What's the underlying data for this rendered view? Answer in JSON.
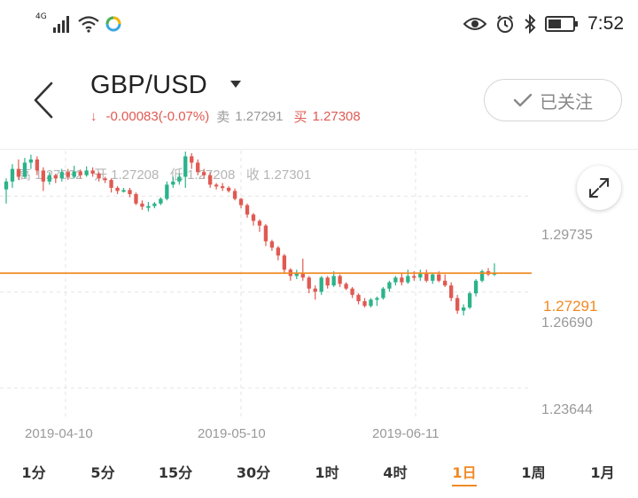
{
  "status_bar": {
    "network": "4G",
    "time": "7:52",
    "icons": [
      "signal-icon",
      "wifi-icon",
      "app-notification-icon",
      "eye-icon",
      "alarm-icon",
      "bluetooth-icon",
      "battery-icon"
    ]
  },
  "header": {
    "pair": "GBP/USD",
    "change_arrow": "↓",
    "change": "-0.00083(-0.07%)",
    "sell_label": "卖",
    "sell_price": "1.27291",
    "buy_label": "买",
    "buy_price": "1.27308",
    "follow_label": "已关注"
  },
  "ohlc": {
    "high_label": "高",
    "high": "1.27832",
    "open_label": "开",
    "open": "1.27208",
    "low_label": "低",
    "low": "1.27208",
    "close_label": "收",
    "close": "1.27301"
  },
  "colors": {
    "accent": "#f08a24",
    "down": "#e05a52",
    "up": "#2bb38a",
    "grid": "#e5e5e5"
  },
  "chart_data": {
    "type": "candlestick",
    "y_ticks": [
      "1.29735",
      "1.26690",
      "1.23644"
    ],
    "current_price": "1.27291",
    "x_ticks": [
      "2019-04-10",
      "2019-05-10",
      "2019-06-11"
    ],
    "ylim": [
      1.2274,
      1.3118
    ],
    "grid": true,
    "candles": [
      [
        1.2995,
        1.302,
        1.295,
        1.303
      ],
      [
        1.302,
        1.306,
        1.3,
        1.3075
      ],
      [
        1.306,
        1.3035,
        1.3025,
        1.309
      ],
      [
        1.3035,
        1.308,
        1.303,
        1.3095
      ],
      [
        1.308,
        1.309,
        1.306,
        1.3105
      ],
      [
        1.309,
        1.3055,
        1.304,
        1.31
      ],
      [
        1.3055,
        1.302,
        1.299,
        1.3065
      ],
      [
        1.302,
        1.304,
        1.301,
        1.305
      ],
      [
        1.304,
        1.303,
        1.3015,
        1.3045
      ],
      [
        1.303,
        1.305,
        1.302,
        1.306
      ],
      [
        1.305,
        1.3035,
        1.3025,
        1.306
      ],
      [
        1.3035,
        1.3052,
        1.303,
        1.307
      ],
      [
        1.3052,
        1.304,
        1.303,
        1.3058
      ],
      [
        1.304,
        1.3055,
        1.3035,
        1.3068
      ],
      [
        1.3055,
        1.3045,
        1.3035,
        1.3065
      ],
      [
        1.3045,
        1.303,
        1.302,
        1.305
      ],
      [
        1.303,
        1.3025,
        1.3015,
        1.3035
      ],
      [
        1.3025,
        1.3,
        1.2985,
        1.303
      ],
      [
        1.3,
        1.299,
        1.298,
        1.3005
      ],
      [
        1.299,
        1.2993,
        1.2985,
        1.3
      ],
      [
        1.2993,
        1.298,
        1.297,
        1.3
      ],
      [
        1.298,
        1.295,
        1.2945,
        1.2985
      ],
      [
        1.295,
        1.294,
        1.293,
        1.296
      ],
      [
        1.294,
        1.2942,
        1.2925,
        1.2955
      ],
      [
        1.2942,
        1.295,
        1.2935,
        1.2955
      ],
      [
        1.295,
        1.2965,
        1.2945,
        1.297
      ],
      [
        1.2965,
        1.301,
        1.296,
        1.302
      ],
      [
        1.301,
        1.302,
        1.3,
        1.3035
      ],
      [
        1.302,
        1.3035,
        1.301,
        1.3045
      ],
      [
        1.3035,
        1.31,
        1.3,
        1.3115
      ],
      [
        1.31,
        1.308,
        1.306,
        1.311
      ],
      [
        1.308,
        1.305,
        1.304,
        1.309
      ],
      [
        1.305,
        1.304,
        1.303,
        1.306
      ],
      [
        1.304,
        1.301,
        1.3,
        1.305
      ],
      [
        1.301,
        1.3005,
        1.2995,
        1.3015
      ],
      [
        1.3005,
        1.3,
        1.299,
        1.3015
      ],
      [
        1.3,
        1.299,
        1.2985,
        1.3005
      ],
      [
        1.299,
        1.2965,
        1.296,
        1.2998
      ],
      [
        1.2965,
        1.2945,
        1.2935,
        1.2968
      ],
      [
        1.2945,
        1.2915,
        1.2905,
        1.295
      ],
      [
        1.2915,
        1.2895,
        1.288,
        1.292
      ],
      [
        1.2895,
        1.288,
        1.286,
        1.29
      ],
      [
        1.288,
        1.283,
        1.2815,
        1.2885
      ],
      [
        1.283,
        1.281,
        1.28,
        1.2835
      ],
      [
        1.281,
        1.2785,
        1.277,
        1.2815
      ],
      [
        1.2785,
        1.274,
        1.273,
        1.279
      ],
      [
        1.274,
        1.272,
        1.2705,
        1.2745
      ],
      [
        1.272,
        1.273,
        1.271,
        1.274
      ],
      [
        1.273,
        1.2715,
        1.2705,
        1.2775
      ],
      [
        1.2715,
        1.268,
        1.2665,
        1.272
      ],
      [
        1.268,
        1.267,
        1.2645,
        1.269
      ],
      [
        1.267,
        1.2715,
        1.266,
        1.272
      ],
      [
        1.2715,
        1.269,
        1.268,
        1.272
      ],
      [
        1.269,
        1.272,
        1.2685,
        1.2735
      ],
      [
        1.272,
        1.2695,
        1.2685,
        1.2725
      ],
      [
        1.2695,
        1.268,
        1.2675,
        1.27
      ],
      [
        1.268,
        1.266,
        1.265,
        1.2685
      ],
      [
        1.266,
        1.264,
        1.263,
        1.2665
      ],
      [
        1.264,
        1.2625,
        1.262,
        1.265
      ],
      [
        1.2625,
        1.2645,
        1.262,
        1.265
      ],
      [
        1.2645,
        1.265,
        1.2625,
        1.2655
      ],
      [
        1.265,
        1.268,
        1.2645,
        1.2685
      ],
      [
        1.268,
        1.27,
        1.267,
        1.2705
      ],
      [
        1.27,
        1.2715,
        1.269,
        1.272
      ],
      [
        1.2715,
        1.27,
        1.269,
        1.273
      ],
      [
        1.27,
        1.272,
        1.2695,
        1.274
      ],
      [
        1.272,
        1.2715,
        1.2705,
        1.2735
      ],
      [
        1.2715,
        1.2728,
        1.2705,
        1.274
      ],
      [
        1.2728,
        1.2705,
        1.27,
        1.274
      ],
      [
        1.2705,
        1.2725,
        1.2695,
        1.273
      ],
      [
        1.2725,
        1.2705,
        1.27,
        1.2735
      ],
      [
        1.2705,
        1.269,
        1.2685,
        1.2725
      ],
      [
        1.269,
        1.265,
        1.264,
        1.27
      ],
      [
        1.265,
        1.261,
        1.26,
        1.266
      ],
      [
        1.261,
        1.262,
        1.2595,
        1.263
      ],
      [
        1.262,
        1.2665,
        1.2615,
        1.267
      ],
      [
        1.2665,
        1.2705,
        1.2655,
        1.271
      ],
      [
        1.2705,
        1.2735,
        1.27,
        1.274
      ],
      [
        1.2735,
        1.2725,
        1.272,
        1.2745
      ],
      [
        1.2725,
        1.273,
        1.272,
        1.276
      ]
    ]
  },
  "tabs": [
    {
      "label": "1分",
      "active": false
    },
    {
      "label": "5分",
      "active": false
    },
    {
      "label": "15分",
      "active": false
    },
    {
      "label": "30分",
      "active": false
    },
    {
      "label": "1时",
      "active": false
    },
    {
      "label": "4时",
      "active": false
    },
    {
      "label": "1日",
      "active": true
    },
    {
      "label": "1周",
      "active": false
    },
    {
      "label": "1月",
      "active": false
    }
  ]
}
